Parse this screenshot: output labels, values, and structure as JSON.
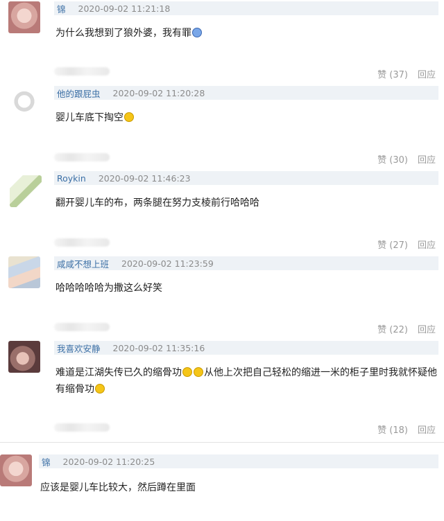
{
  "comments": [
    {
      "user": "锦",
      "time": "2020-09-02 11:21:18",
      "text": "为什么我想到了狼外婆，我有罪",
      "emoji": [
        "😱"
      ],
      "like": "赞 (37)",
      "reply": "回应"
    },
    {
      "user": "他的跟屁虫",
      "time": "2020-09-02 11:20:28",
      "text": "婴儿车底下掏空",
      "emoji": [
        "😂"
      ],
      "like": "赞 (30)",
      "reply": "回应"
    },
    {
      "user": "Roykin",
      "time": "2020-09-02 11:46:23",
      "text": "翻开婴儿车的布，两条腿在努力支棱前行哈哈哈",
      "like": "赞 (27)",
      "reply": "回应"
    },
    {
      "user": "咸咸不想上班",
      "time": "2020-09-02 11:23:59",
      "text": "哈哈哈哈哈为撒这么好笑",
      "like": "赞 (22)",
      "reply": "回应"
    },
    {
      "user": "我喜欢安静",
      "time": "2020-09-02 11:35:16",
      "text_part1": "难道是江湖失传已久的缩骨功",
      "text_part2": "从他上次把自己轻松的缩进一米的柜子里时我就怀疑他",
      "text_line2": "有缩骨功",
      "emoji": [
        "🤔",
        "🤔",
        "😄"
      ],
      "like": "赞 (18)",
      "reply": "回应"
    },
    {
      "user": "锦",
      "time": "2020-09-02 11:20:25",
      "text": "应该是婴儿车比较大，然后蹲在里面"
    }
  ],
  "colors": {
    "username": "#3b6fa5",
    "meta_bg": "#eef2f6",
    "action": "#9a9a9a"
  }
}
